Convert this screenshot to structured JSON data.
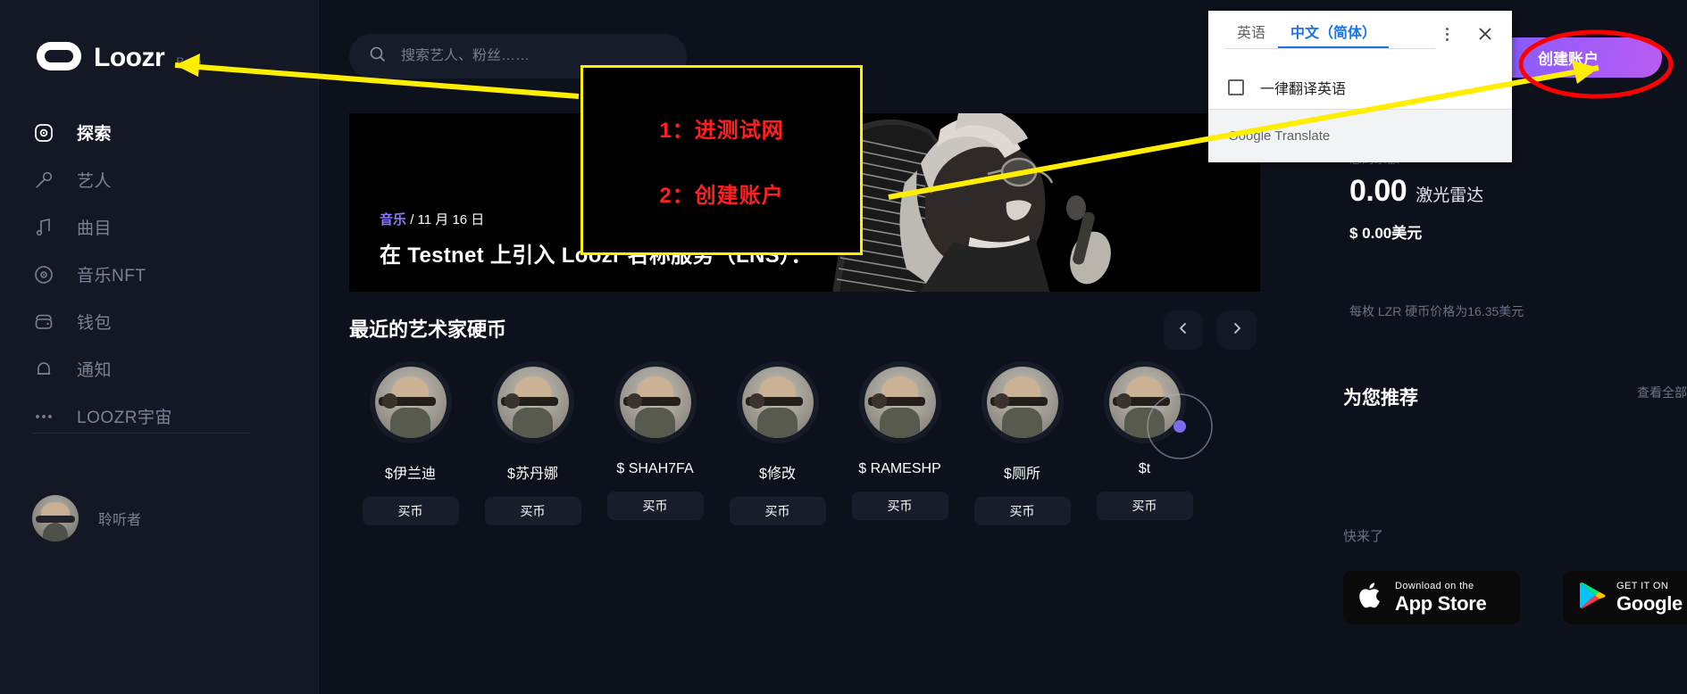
{
  "brand": {
    "name": "Loozr",
    "tag": "Beta",
    "logo_icon": "loozr-logo-icon"
  },
  "sidebar": {
    "items": [
      {
        "label": "探索",
        "icon": "compass-icon",
        "active": true
      },
      {
        "label": "艺人",
        "icon": "microphone-icon",
        "active": false
      },
      {
        "label": "曲目",
        "icon": "music-note-icon",
        "active": false
      },
      {
        "label": "音乐NFT",
        "icon": "disc-icon",
        "active": false
      },
      {
        "label": "钱包",
        "icon": "wallet-icon",
        "active": false
      },
      {
        "label": "通知",
        "icon": "bell-icon",
        "active": false
      },
      {
        "label": "LOOZR宇宙",
        "icon": "ellipsis-icon",
        "active": false
      }
    ],
    "user": {
      "name": "聆听者",
      "avatar_icon": "user-avatar"
    }
  },
  "search": {
    "placeholder": "搜索艺人、粉丝……",
    "value": "",
    "icon": "search-icon"
  },
  "hero": {
    "category": "音乐",
    "separator": "/",
    "date": "11 月 16 日",
    "title": "在 Testnet 上引入 Loozr 名称服务（LNS）："
  },
  "coins_section": {
    "title": "最近的艺术家硬币",
    "prev_icon": "chevron-left-icon",
    "next_icon": "chevron-right-icon",
    "buy_label": "买币",
    "items": [
      {
        "name": "$伊兰迪"
      },
      {
        "name": "$苏丹娜"
      },
      {
        "name": "$ SHAH7FA"
      },
      {
        "name": "$修改"
      },
      {
        "name": "$ RAMESHP"
      },
      {
        "name": "$厕所"
      },
      {
        "name": "$t"
      }
    ]
  },
  "right_panel": {
    "cta_label": "创建账户",
    "balance_label": "您的余额",
    "balance_amount": "0.00",
    "balance_unit": "激光雷达",
    "balance_usd": "$ 0.00美元",
    "coin_price_note": "每枚 LZR 硬币价格为16.35美元",
    "recommend_title": "为您推荐",
    "view_all": "查看全部",
    "empty_text": "快来了",
    "stores": [
      {
        "small": "Download on the",
        "large": "App Store",
        "icon": "apple-icon"
      },
      {
        "small": "GET IT ON",
        "large": "Google Play",
        "icon": "google-play-icon"
      }
    ]
  },
  "translate_popup": {
    "tab_source": "英语",
    "tab_target": "中文（简体）",
    "checkbox_label": "一律翻译英语",
    "checkbox_checked": false,
    "footer_brand": "Google Translate",
    "kebab_icon": "more-options-icon",
    "close_icon": "close-icon"
  },
  "annotations": {
    "step1": "1：进测试网",
    "step2": "2：创建账户",
    "box_border_color": "#ffee00",
    "text_color": "#ff1f1f",
    "arrow_color": "#ffee00",
    "ellipse_color": "#ff0000"
  },
  "colors": {
    "accent_purple": "#8a7bff",
    "cta_gradient_start": "#7c5cff",
    "cta_gradient_end": "#b95cf0",
    "sidebar_bg": "#141824",
    "main_bg": "#0d111b"
  }
}
